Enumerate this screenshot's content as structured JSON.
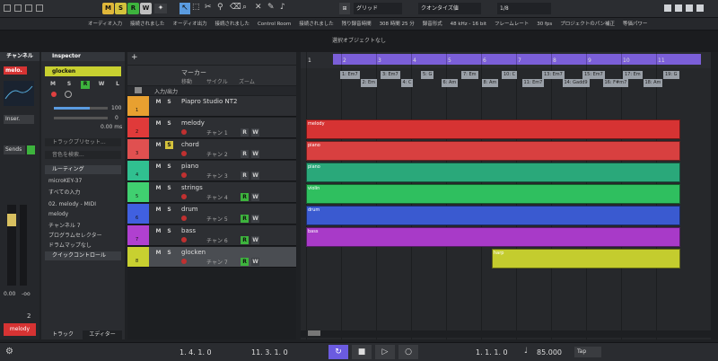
{
  "toolbar": {
    "btn_m": "M",
    "btn_s": "S",
    "btn_r": "R",
    "btn_w": "W",
    "grid_label": "グリッド",
    "quantize_label": "クオンタイズ値",
    "quantize_value": "1/8",
    "colors": {
      "m": "#e0b73a",
      "s": "#d4c23c",
      "r": "#3db33d",
      "w": "#c0c0c0",
      "select": "#5a9be0"
    }
  },
  "status": [
    "オーディオ入力",
    "接続されました",
    "オーディオ出力",
    "接続されました",
    "Control Room",
    "接続されました",
    "残り録音時間",
    "308 時間 25 分",
    "録音形式",
    "48 kHz - 16 bit",
    "フレームレート",
    "30 fps",
    "プロジェクトのパン補正",
    "等価パワー"
  ],
  "selection_info": "選択オブジェクトなし",
  "left_zone": {
    "tab_channel": "チャンネル",
    "channel_name": "melo.",
    "sends": "Sends",
    "fader_values": [
      "0.00",
      "-oo"
    ],
    "vol_display": "2",
    "bottom_name": "melody",
    "tab_track": "トラック",
    "tab_editor": "エディター"
  },
  "inspector": {
    "tab": "Inspector",
    "track_name": "glocken",
    "btn_m": "M",
    "btn_s": "S",
    "btn_r": "R",
    "btn_w": "W",
    "btn_l": "L",
    "volume": "100",
    "pan": "0",
    "delay": "0.00 ms",
    "preset_placeholder": "トラックプリセット...",
    "search_placeholder": "音色を検索...",
    "routing_label": "ルーティング",
    "midi_in": "microKEY-37",
    "all_inputs": "すべての入力",
    "midi_out": "02. melody - MIDI",
    "out_name": "melody",
    "channel": "チャンネル 7",
    "program": "プログラムセレクター",
    "drum_map": "ドラムマップなし",
    "quick_controls": "クイックコントロール"
  },
  "tracklist": {
    "header_marker": "マーカー",
    "marker_sub": [
      "移動",
      "サイクル",
      "ズーム"
    ],
    "io_label": "入力/出力",
    "tracks": [
      {
        "num": "1",
        "name": "Piapro Studio NT2",
        "color": "#e8a030",
        "kind": "instrument"
      },
      {
        "num": "2",
        "name": "melody",
        "color": "#e03a3a",
        "ch": "チャン 1"
      },
      {
        "num": "3",
        "name": "chord",
        "color": "#e05050",
        "ch": "チャン 2"
      },
      {
        "num": "4",
        "name": "piano",
        "color": "#30c090",
        "ch": "チャン 3"
      },
      {
        "num": "5",
        "name": "strings",
        "color": "#40d070",
        "ch": "チャン 4"
      },
      {
        "num": "6",
        "name": "drum",
        "color": "#4060e0",
        "ch": "チャン 5"
      },
      {
        "num": "7",
        "name": "bass",
        "color": "#b040d0",
        "ch": "チャン 6"
      },
      {
        "num": "8",
        "name": "glocken",
        "color": "#c8d030",
        "ch": "チャン 7"
      }
    ]
  },
  "arrange": {
    "bars": [
      "1",
      "2",
      "3",
      "4",
      "5",
      "6",
      "7",
      "8",
      "9",
      "10",
      "11"
    ],
    "markers": [
      "1: Em7",
      "2: Em",
      "3: Em7",
      "4: C",
      "5: G",
      "6: Am",
      "7: Em",
      "8: Am",
      "10: C",
      "11: Em7",
      "13: Em7",
      "14: Gadd9",
      "15: Em7",
      "16: F#m7",
      "17: Em",
      "18: Am",
      "19: G"
    ],
    "parts": [
      {
        "label": "melody",
        "row": 2,
        "color": "#d63333"
      },
      {
        "label": "piano",
        "row": 3,
        "color": "#d84040"
      },
      {
        "label": "piano",
        "row": 4,
        "color": "#2aa87a"
      },
      {
        "label": "violin",
        "row": 5,
        "color": "#2fbf5f"
      },
      {
        "label": "drum",
        "row": 6,
        "color": "#3a5ad0"
      },
      {
        "label": "bass",
        "row": 7,
        "color": "#a83ac8"
      },
      {
        "label": "harp",
        "row": 8,
        "color": "#c4cc2e"
      }
    ]
  },
  "transport": {
    "pos_left": "1. 4. 1. 0",
    "pos_right": "11. 3. 1. 0",
    "pos_main": "1. 1. 1. 0",
    "tempo": "85.000",
    "tap": "Tap"
  }
}
